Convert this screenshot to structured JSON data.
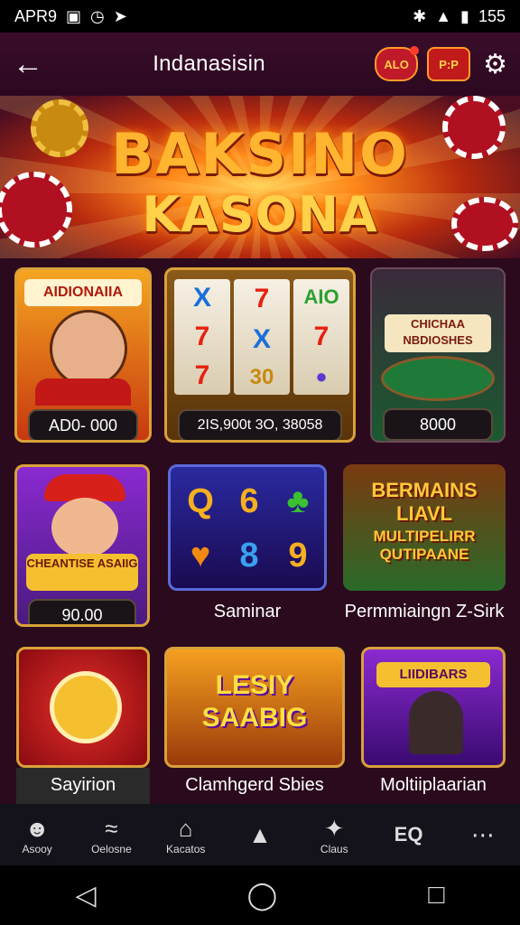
{
  "status": {
    "time": "APR9",
    "right_text": "155"
  },
  "appbar": {
    "title": "Indanasisin",
    "badge1": "ALO",
    "badge2": "P:P"
  },
  "hero": {
    "line1": "BAKSINO",
    "line2": "KASONA"
  },
  "tiles": [
    {
      "title": "AIDIONAIIA",
      "value": "AD0- 000"
    },
    {
      "reels": [
        "X",
        "7",
        "7",
        "7",
        "X",
        "30",
        "AIO",
        "7",
        "●"
      ],
      "value": "2IS,900t 3O, 38058"
    },
    {
      "title": "CHICHAA NBDIOSHES",
      "value": "8000"
    },
    {
      "title": "CHEANTISE ASAIIG",
      "value": "90.00"
    },
    {
      "reels": [
        "Q",
        "♥",
        "6",
        "8",
        "♣",
        "9"
      ],
      "label": "Saminar"
    },
    {
      "title1": "BERMAINS LIAVL",
      "title2": "MULTIPELIRR QUTIPAANE",
      "label": "Permmiaingn Z-Sirk"
    },
    {
      "label": "Sayirion"
    },
    {
      "title": "LESIY SAABIG",
      "label": "Clamhgerd Sbies"
    },
    {
      "title": "LIIDIBARS",
      "label": "Moltiiplaarian"
    }
  ],
  "nav": [
    {
      "label": "Asooy",
      "icon": "avatar-icon"
    },
    {
      "label": "Oelosne",
      "icon": "wifi-icon"
    },
    {
      "label": "Kacatos",
      "icon": "home-icon"
    },
    {
      "label": "",
      "icon": "tree-icon"
    },
    {
      "label": "Claus",
      "icon": "puzzle-icon"
    },
    {
      "label": "",
      "icon": "search-icon",
      "glyph": "EQ"
    },
    {
      "label": "",
      "icon": "more-icon"
    }
  ],
  "colors": {
    "bg": "#2a0a1c",
    "gold": "#d9a13a",
    "accent": "#ff8a1c"
  }
}
